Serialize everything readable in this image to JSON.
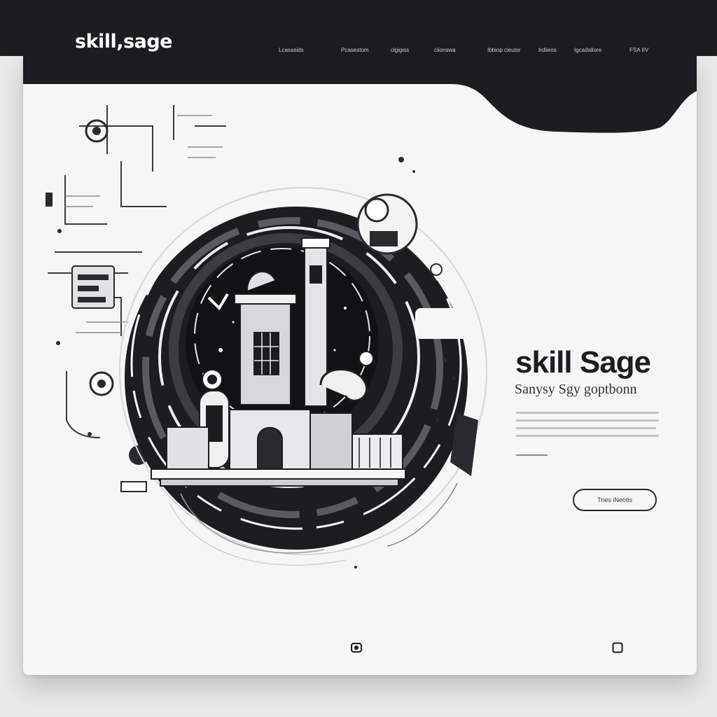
{
  "header": {
    "logo": "skill,sage",
    "nav": [
      "Lcasasids",
      "Pcasestom",
      "clgigiss",
      "ciionswa",
      "Ibbiop cieutsr",
      "Irdiieos",
      "Igcadaliore",
      "FSA IIV"
    ]
  },
  "hero": {
    "title": "skill Sage",
    "subtitle": "Sanysy Sgy goptbonn",
    "cta_label": "Tnes iNeotis"
  },
  "colors": {
    "dark": "#1d1d21",
    "card": "#f6f6f6",
    "page": "#e9e9e9"
  },
  "icons": {
    "illustration": "retro-futuristic-building-in-circular-portal",
    "footer_left": "camera-icon",
    "footer_right": "square-icon"
  }
}
